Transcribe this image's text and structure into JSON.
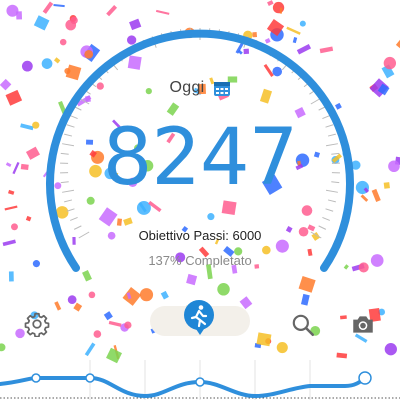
{
  "header": {
    "date_label": "Oggi"
  },
  "counter": {
    "steps": "8247",
    "goal_text": "Obiettivo Passi: 6000",
    "progress_text": "137% Completato",
    "progress_fraction": 1.37
  },
  "icons": {
    "settings": "gear-icon",
    "calendar": "calendar-icon",
    "activity": "walking-person-icon",
    "search": "search-icon",
    "camera": "camera-icon"
  },
  "colors": {
    "accent": "#2f8fdc",
    "dial": "#2f8fdc",
    "activity_button": "#1f86d6"
  }
}
